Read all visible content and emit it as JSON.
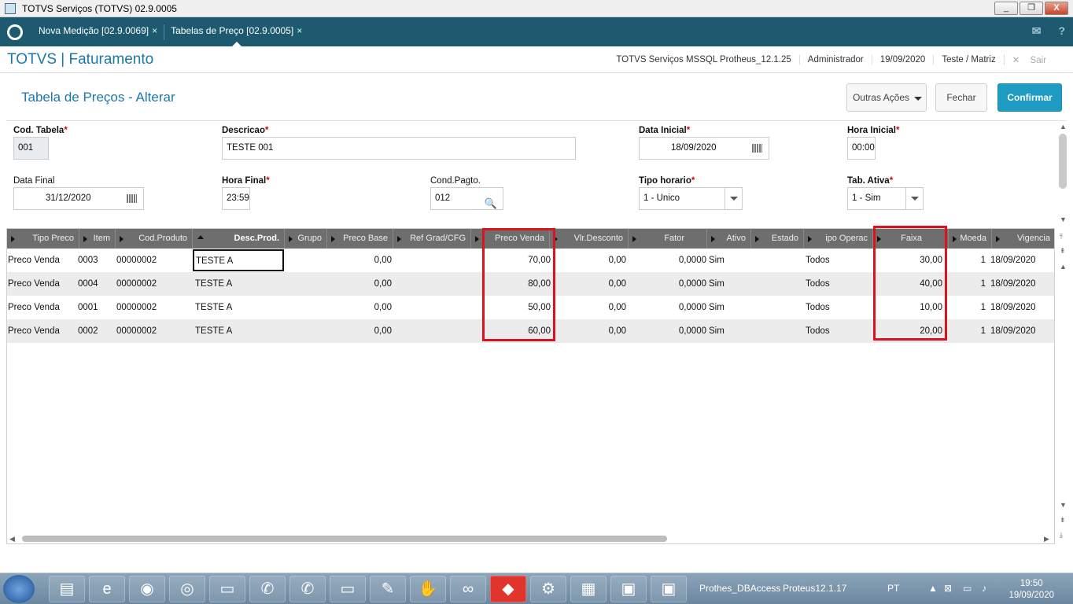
{
  "window": {
    "title": "TOTVS Serviços (TOTVS) 02.9.0005",
    "minimize": "_",
    "restore": "❐",
    "close": "X"
  },
  "tabs": [
    {
      "label": "Nova Medição [02.9.0069]",
      "close": "×"
    },
    {
      "label": "Tabelas de Preço [02.9.0005]",
      "close": "×"
    }
  ],
  "header": {
    "brand": "TOTVS | Faturamento",
    "env": "TOTVS Serviços MSSQL Protheus_12.1.25",
    "user": "Administrador",
    "date": "19/09/2020",
    "branch": "Teste / Matriz",
    "logout": "Sair"
  },
  "page": {
    "title": "Tabela de Preços - Alterar"
  },
  "actions": {
    "more": "Outras Ações",
    "close": "Fechar",
    "confirm": "Confirmar"
  },
  "form": {
    "cod_tabela": {
      "label": "Cod. Tabela",
      "value": "001"
    },
    "descricao": {
      "label": "Descricao",
      "value": "TESTE 001"
    },
    "data_inicial": {
      "label": "Data Inicial",
      "value": "18/09/2020"
    },
    "hora_inicial": {
      "label": "Hora Inicial",
      "value": "00:00"
    },
    "data_final": {
      "label": "Data Final",
      "value": "31/12/2020"
    },
    "hora_final": {
      "label": "Hora Final",
      "value": "23:59"
    },
    "cond_pagto": {
      "label": "Cond.Pagto.",
      "value": "012"
    },
    "tipo_horario": {
      "label": "Tipo horario",
      "value": "1 - Unico"
    },
    "tab_ativa": {
      "label": "Tab. Ativa",
      "value": "1 - Sim"
    },
    "required_mark": "*"
  },
  "grid": {
    "columns": [
      "Tipo Preco",
      "Item",
      "Cod.Produto",
      "Desc.Prod.",
      "Grupo",
      "Preco Base",
      "Ref Grad/CFG",
      "Preco Venda",
      "Vlr.Desconto",
      "Fator",
      "Ativo",
      "Estado",
      "ipo Operac",
      "Faixa",
      "Moeda",
      "Vigencia"
    ],
    "rows": [
      [
        "Preco Venda",
        "0003",
        "00000002",
        "TESTE A",
        "",
        "0,00",
        "",
        "70,00",
        "0,00",
        "0,0000",
        "Sim",
        "",
        "Todos",
        "30,00",
        "1",
        "18/09/2020"
      ],
      [
        "Preco Venda",
        "0004",
        "00000002",
        "TESTE A",
        "",
        "0,00",
        "",
        "80,00",
        "0,00",
        "0,0000",
        "Sim",
        "",
        "Todos",
        "40,00",
        "1",
        "18/09/2020"
      ],
      [
        "Preco Venda",
        "0001",
        "00000002",
        "TESTE A",
        "",
        "0,00",
        "",
        "50,00",
        "0,00",
        "0,0000",
        "Sim",
        "",
        "Todos",
        "10,00",
        "1",
        "18/09/2020"
      ],
      [
        "Preco Venda",
        "0002",
        "00000002",
        "TESTE A",
        "",
        "0,00",
        "",
        "60,00",
        "0,00",
        "0,0000",
        "Sim",
        "",
        "Todos",
        "20,00",
        "1",
        "18/09/2020"
      ]
    ]
  },
  "taskbar": {
    "labels": [
      "Prothes_DBAccess",
      "Proteus12.1.17"
    ],
    "lang": "PT",
    "time": "19:50",
    "date": "19/09/2020",
    "icons": [
      "explorer-icon",
      "ie-icon",
      "remote-icon",
      "chrome-icon",
      "monitor-icon",
      "phone-icon",
      "phone-icon",
      "monitor-icon",
      "paint-icon",
      "glove-icon",
      "infinity-icon",
      "anydesk-icon",
      "settings-icon",
      "calculator-icon",
      "screen-icon",
      "screen-icon"
    ]
  }
}
